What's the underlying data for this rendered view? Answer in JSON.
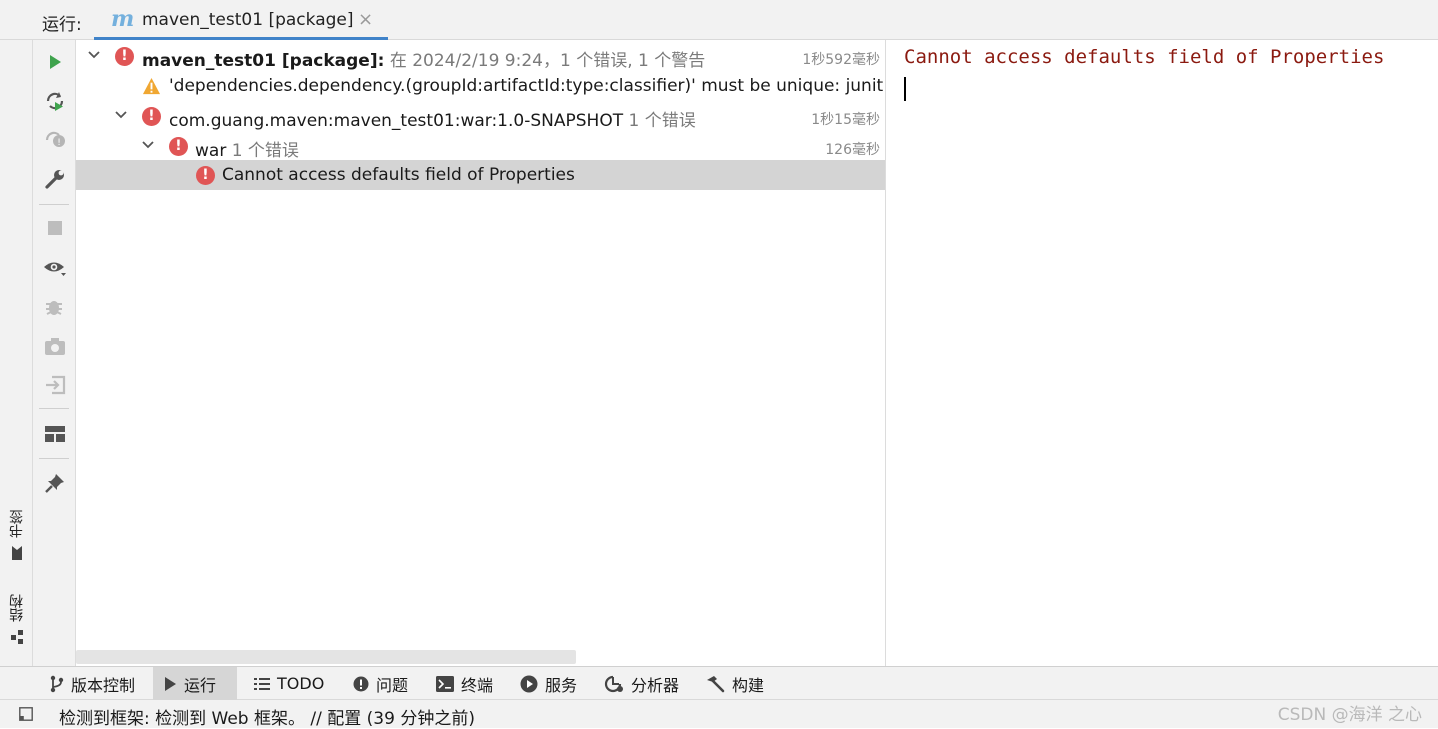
{
  "header": {
    "run_label": "运行:",
    "tab_title": "maven_test01 [package]",
    "close_glyph": "×"
  },
  "sidebar": {
    "bookmarks_label": "书签",
    "structure_label": "结构"
  },
  "toolbar_icons": [
    "run-icon",
    "rerun-icon",
    "rerun-failed-icon",
    "wrench-icon",
    "stop-icon",
    "eye-icon",
    "debug-icon",
    "camera-icon",
    "import-icon",
    "layout-icon",
    "pin-icon"
  ],
  "tree": {
    "rows": [
      {
        "name": "maven_test01 [package]:",
        "meta": " 在 2024/2/19 9:24，1 个错误, 1 个警告",
        "duration": "1秒592毫秒",
        "status": "error"
      },
      {
        "name": "'dependencies.dependency.(groupId:artifactId:type:classifier)' must be unique: junit:junit:jar -> vers",
        "meta": "",
        "duration": "",
        "status": "warning"
      },
      {
        "name": "com.guang.maven:maven_test01:war:1.0-SNAPSHOT",
        "meta": "  1 个错误",
        "duration": "1秒15毫秒",
        "status": "error"
      },
      {
        "name": "war",
        "meta": "  1 个错误",
        "duration": "126毫秒",
        "status": "error"
      },
      {
        "name": "Cannot access defaults field of Properties",
        "meta": "",
        "duration": "",
        "status": "error"
      }
    ]
  },
  "console": {
    "text": "Cannot access defaults field of Properties"
  },
  "tool_windows": [
    {
      "label": "版本控制",
      "icon": "branch-icon",
      "active": false
    },
    {
      "label": "运行",
      "icon": "run-icon",
      "active": true
    },
    {
      "label": "TODO",
      "icon": "list-icon",
      "active": false
    },
    {
      "label": "问题",
      "icon": "problems-icon",
      "active": false
    },
    {
      "label": "终端",
      "icon": "terminal-icon",
      "active": false
    },
    {
      "label": "服务",
      "icon": "services-icon",
      "active": false
    },
    {
      "label": "分析器",
      "icon": "profiler-icon",
      "active": false
    },
    {
      "label": "构建",
      "icon": "hammer-icon",
      "active": false
    }
  ],
  "status_bar": {
    "text": "检测到框架: 检测到 Web 框架。 // 配置 (39 分钟之前)",
    "watermark": "CSDN @海洋 之心"
  },
  "colors": {
    "error": "#e05555",
    "warning": "#f0a732",
    "console_error_text": "#8b1a10",
    "tab_underline": "#4083c9",
    "run_green": "#3fa34d"
  }
}
